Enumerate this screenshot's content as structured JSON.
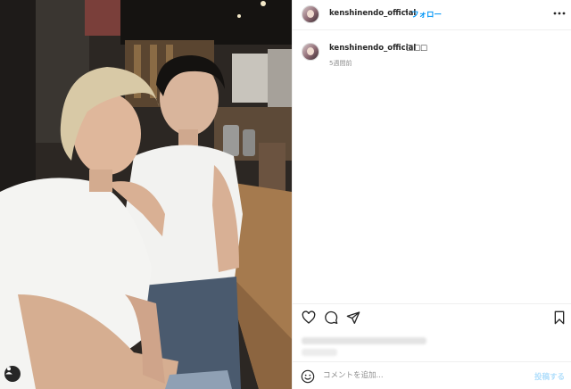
{
  "post": {
    "username": "kenshinendo_official",
    "separator": "•",
    "follow_label": "フォロー",
    "more_icon": "more-horizontal-icon",
    "avatar_icon": "profile-avatar"
  },
  "caption": {
    "username": "kenshinendo_official",
    "text": "□□□",
    "time_ago": "5週間前"
  },
  "actions": {
    "icons": [
      "heart-icon",
      "comment-icon",
      "share-icon",
      "bookmark-icon"
    ]
  },
  "comment": {
    "placeholder": "コメントを追加...",
    "post_label": "投稿する",
    "emoji_icon": "smile-icon"
  },
  "photo": {
    "tag_icon": "user-tag-icon"
  },
  "colors": {
    "accent": "#0095f6",
    "post_disabled": "#b2dffc",
    "border": "#efefef",
    "secondary_text": "#8e8e8e"
  }
}
